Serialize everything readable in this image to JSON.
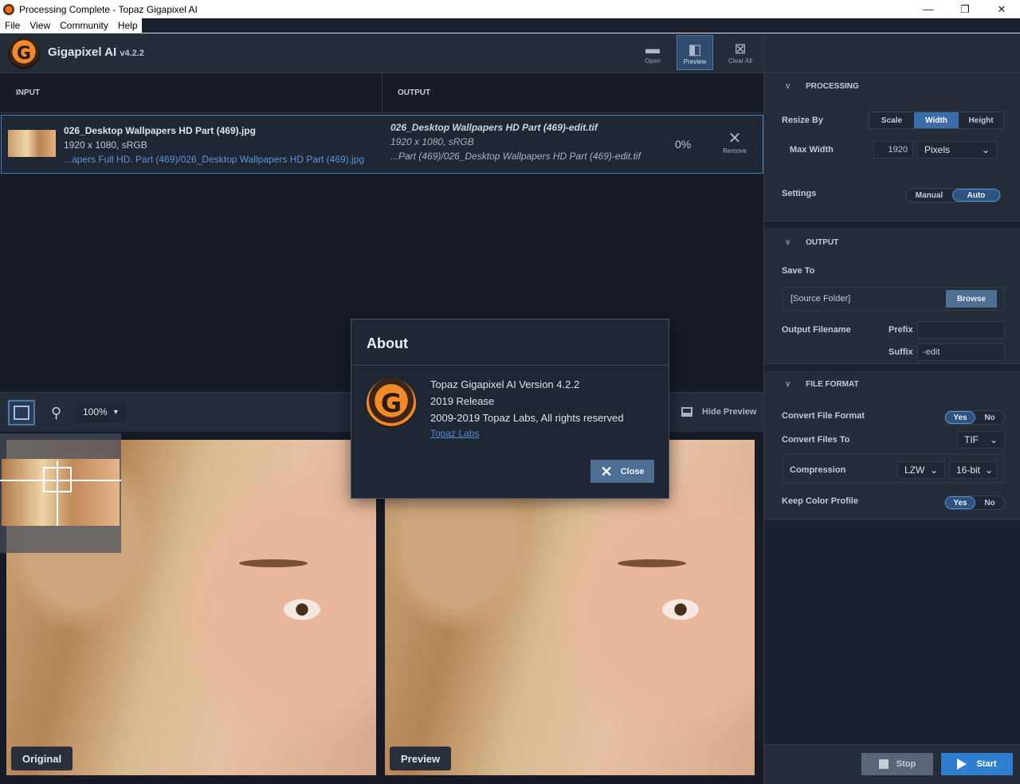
{
  "window": {
    "title": "Processing Complete - Topaz Gigapixel AI",
    "controls": [
      "—",
      "❐",
      "✕"
    ]
  },
  "menu": [
    "File",
    "View",
    "Community",
    "Help"
  ],
  "header": {
    "logo_letter": "G",
    "app_name": "Gigapixel AI",
    "version": "v4.2.2",
    "toolbar": [
      {
        "label": "Open",
        "icon": "folder-icon"
      },
      {
        "label": "Preview",
        "icon": "preview-split-icon",
        "active": true
      },
      {
        "label": "Clear All",
        "icon": "clear-all-icon"
      }
    ]
  },
  "columns": {
    "input": "INPUT",
    "output": "OUTPUT"
  },
  "file": {
    "input_name": "026_Desktop Wallpapers  HD Part (469).jpg",
    "input_dim": "1920 x 1080, sRGB",
    "input_path": "...apers Full HD. Part (469)/026_Desktop Wallpapers  HD Part (469).jpg",
    "output_name": "026_Desktop Wallpapers  HD Part (469)-edit.tif",
    "output_dim": "1920 x 1080, sRGB",
    "output_path": "...Part (469)/026_Desktop Wallpapers  HD Part (469)-edit.tif",
    "progress": "0%",
    "remove_label": "Remove"
  },
  "preview_bar": {
    "zoom": "100%",
    "hide_preview": "Hide Preview"
  },
  "panes": {
    "left_label": "Original",
    "right_label": "Preview"
  },
  "processing": {
    "title": "PROCESSING",
    "resize_by_label": "Resize By",
    "resize_options": [
      "Scale",
      "Width",
      "Height"
    ],
    "resize_selected": "Width",
    "max_width_label": "Max Width",
    "max_width_value": "1920",
    "unit": "Pixels",
    "settings_label": "Settings",
    "settings_options": [
      "Manual",
      "Auto"
    ],
    "settings_selected": "Auto"
  },
  "output": {
    "title": "OUTPUT",
    "save_to_label": "Save To",
    "save_to_value": "[Source Folder]",
    "browse_label": "Browse",
    "filename_label": "Output Filename",
    "prefix_label": "Prefix",
    "prefix_value": "",
    "suffix_label": "Suffix",
    "suffix_value": "-edit"
  },
  "file_format": {
    "title": "FILE FORMAT",
    "convert_format_label": "Convert File Format",
    "convert_format_options": [
      "Yes",
      "No"
    ],
    "convert_to_label": "Convert Files To",
    "convert_to_value": "TIF",
    "compression_label": "Compression",
    "compression_value": "LZW",
    "bitdepth_value": "16-bit",
    "keep_profile_label": "Keep Color Profile",
    "keep_profile_options": [
      "Yes",
      "No"
    ]
  },
  "actions": {
    "stop": "Stop",
    "start": "Start"
  },
  "about": {
    "title": "About",
    "logo_letter": "G",
    "version_line": "Topaz Gigapixel AI Version 4.2.2",
    "release_line": "2019 Release",
    "copyright_line": "2009-2019 Topaz Labs, All rights reserved",
    "link": "Topaz Labs",
    "close": "Close"
  },
  "colors": {
    "accent": "#3b6ea8",
    "start": "#2f7fd0",
    "link": "#4f8fd6",
    "brand_orange": "#f08a2a"
  }
}
